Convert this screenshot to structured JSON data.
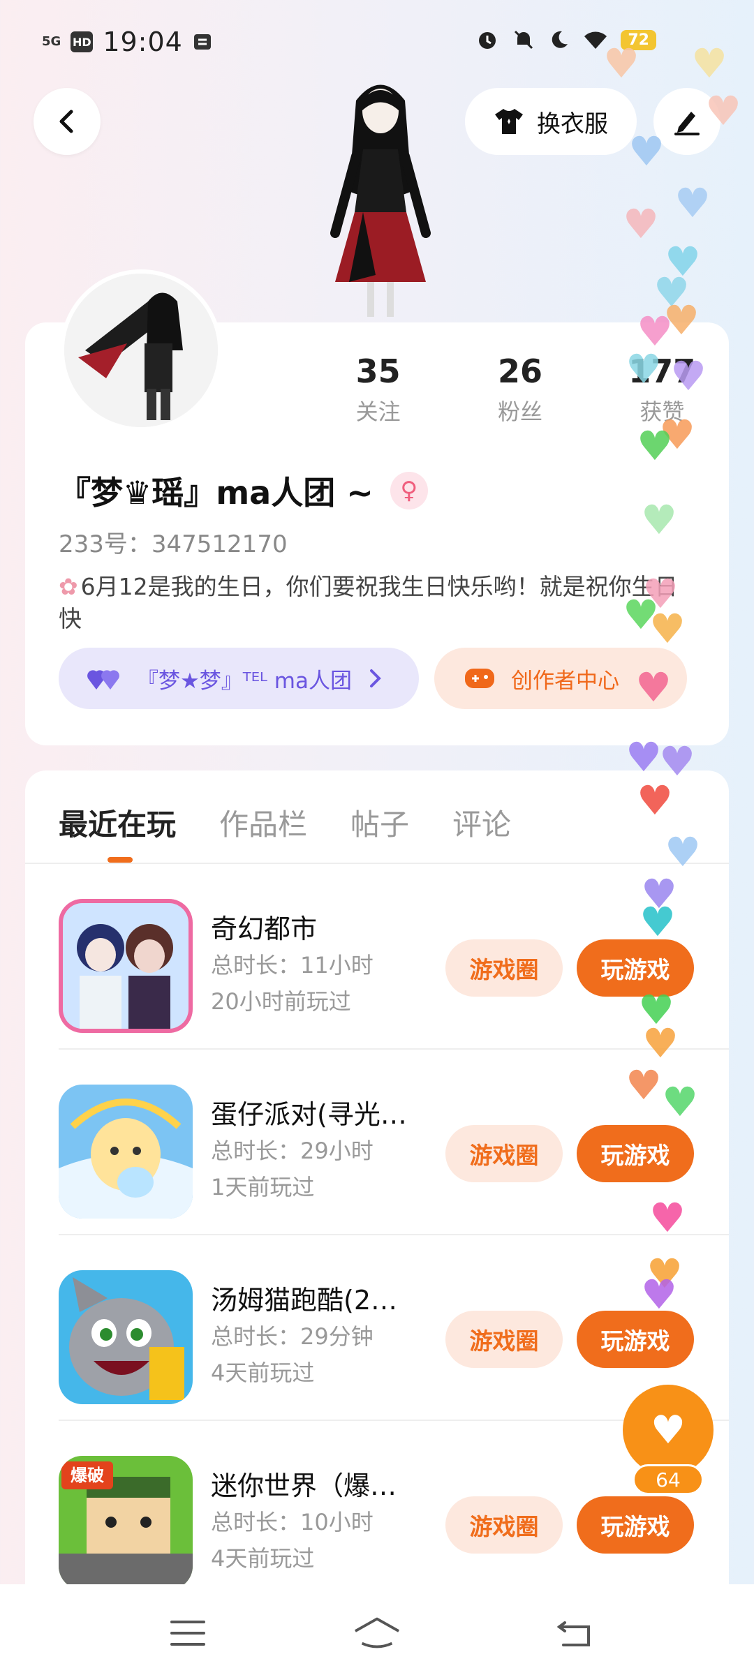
{
  "status_bar": {
    "signal": "5G",
    "hd": "HD",
    "time": "19:04",
    "battery": "72"
  },
  "header": {
    "dress_label": "换衣服"
  },
  "profile": {
    "stats": [
      {
        "num": "35",
        "label": "关注"
      },
      {
        "num": "26",
        "label": "粉丝"
      },
      {
        "num": "177",
        "label": "获赞"
      }
    ],
    "name": "『梦♛瑶』ma人团 ~",
    "gender_symbol": "♀",
    "uid": "233号：347512170",
    "bio": "6月12是我的生日，你们要祝我生日快乐哟！就是祝你生日快",
    "group_label": "『梦★梦』ᵀᴱᴸ ma人团",
    "creator_label": "创作者中心"
  },
  "tabs": [
    "最近在玩",
    "作品栏",
    "帖子",
    "评论"
  ],
  "games": [
    {
      "title": "奇幻都市",
      "duration": "总时长：11小时",
      "last": "20小时前玩过",
      "circle": "游戏圈",
      "play": "玩游戏"
    },
    {
      "title": "蛋仔派对(寻光…",
      "duration": "总时长：29小时",
      "last": "1天前玩过",
      "circle": "游戏圈",
      "play": "玩游戏"
    },
    {
      "title": "汤姆猫跑酷(2…",
      "duration": "总时长：29分钟",
      "last": "4天前玩过",
      "circle": "游戏圈",
      "play": "玩游戏"
    },
    {
      "title": "迷你世界（爆…",
      "duration": "总时长：10小时",
      "last": "4天前玩过",
      "circle": "游戏圈",
      "play": "玩游戏"
    }
  ],
  "game_icon_text": {
    "mini_world_badge": "爆破"
  },
  "like": {
    "count": "64"
  },
  "colors": {
    "accent": "#f06d1c",
    "group_purple": "#6a55e0",
    "like_orange": "#f89117"
  }
}
